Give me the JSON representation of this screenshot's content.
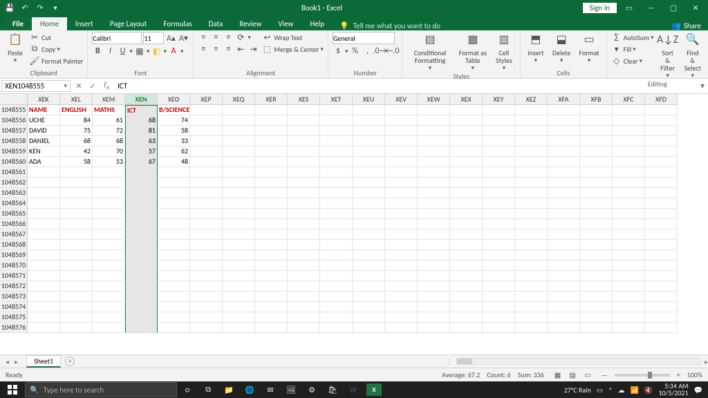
{
  "titlebar": {
    "apptitle": "Book1 - Excel",
    "signin": "Sign in"
  },
  "tabs": {
    "file": "File",
    "home": "Home",
    "insert": "Insert",
    "pagelayout": "Page Layout",
    "formulas": "Formulas",
    "data": "Data",
    "review": "Review",
    "view": "View",
    "help": "Help",
    "tell": "Tell me what you want to do",
    "share": "Share"
  },
  "ribbon": {
    "clipboard": {
      "paste": "Paste",
      "cut": "Cut",
      "copy": "Copy",
      "fp": "Format Painter",
      "label": "Clipboard"
    },
    "font": {
      "name": "Calibri",
      "size": "11",
      "label": "Font"
    },
    "alignment": {
      "wrap": "Wrap Text",
      "merge": "Merge & Center",
      "label": "Alignment"
    },
    "number": {
      "fmt": "General",
      "label": "Number"
    },
    "styles": {
      "cf": "Conditional Formatting",
      "fat": "Format as Table",
      "cs": "Cell Styles",
      "label": "Styles"
    },
    "cells": {
      "ins": "Insert",
      "del": "Delete",
      "fmt": "Format",
      "label": "Cells"
    },
    "editing": {
      "autosum": "AutoSum",
      "fill": "Fill",
      "clear": "Clear",
      "sort": "Sort & Filter",
      "find": "Find & Select",
      "label": "Editing"
    }
  },
  "fbar": {
    "namebox": "XEN1048555",
    "formula": "ICT"
  },
  "columns": [
    "XEK",
    "XEL",
    "XEM",
    "XEN",
    "XEO",
    "XEP",
    "XEQ",
    "XER",
    "XES",
    "XET",
    "XEU",
    "XEV",
    "XEW",
    "XEX",
    "XEY",
    "XEZ",
    "XFA",
    "XFB",
    "XFC",
    "XFD"
  ],
  "selected_col_index": 3,
  "rows_start": 1048555,
  "rows_count": 22,
  "data": {
    "headers": [
      "NAME",
      "ENGLISH",
      "MATHS",
      "ICT",
      "B/SCIENCE"
    ],
    "rows": [
      [
        "UCHE",
        84,
        61,
        68,
        74
      ],
      [
        "DAVID",
        75,
        72,
        81,
        58
      ],
      [
        "DANIEL",
        68,
        68,
        63,
        33
      ],
      [
        "KEN",
        42,
        70,
        57,
        62
      ],
      [
        "ADA",
        58,
        53,
        67,
        48
      ]
    ]
  },
  "sheettab": "Sheet1",
  "status": {
    "ready": "Ready",
    "avg": "Average: 67.2",
    "count": "Count: 6",
    "sum": "Sum: 336",
    "zoom": "100%"
  },
  "taskbar": {
    "search": "Type here to search",
    "weather": "27°C  Rain",
    "time": "5:34 AM",
    "date": "10/5/2021"
  }
}
